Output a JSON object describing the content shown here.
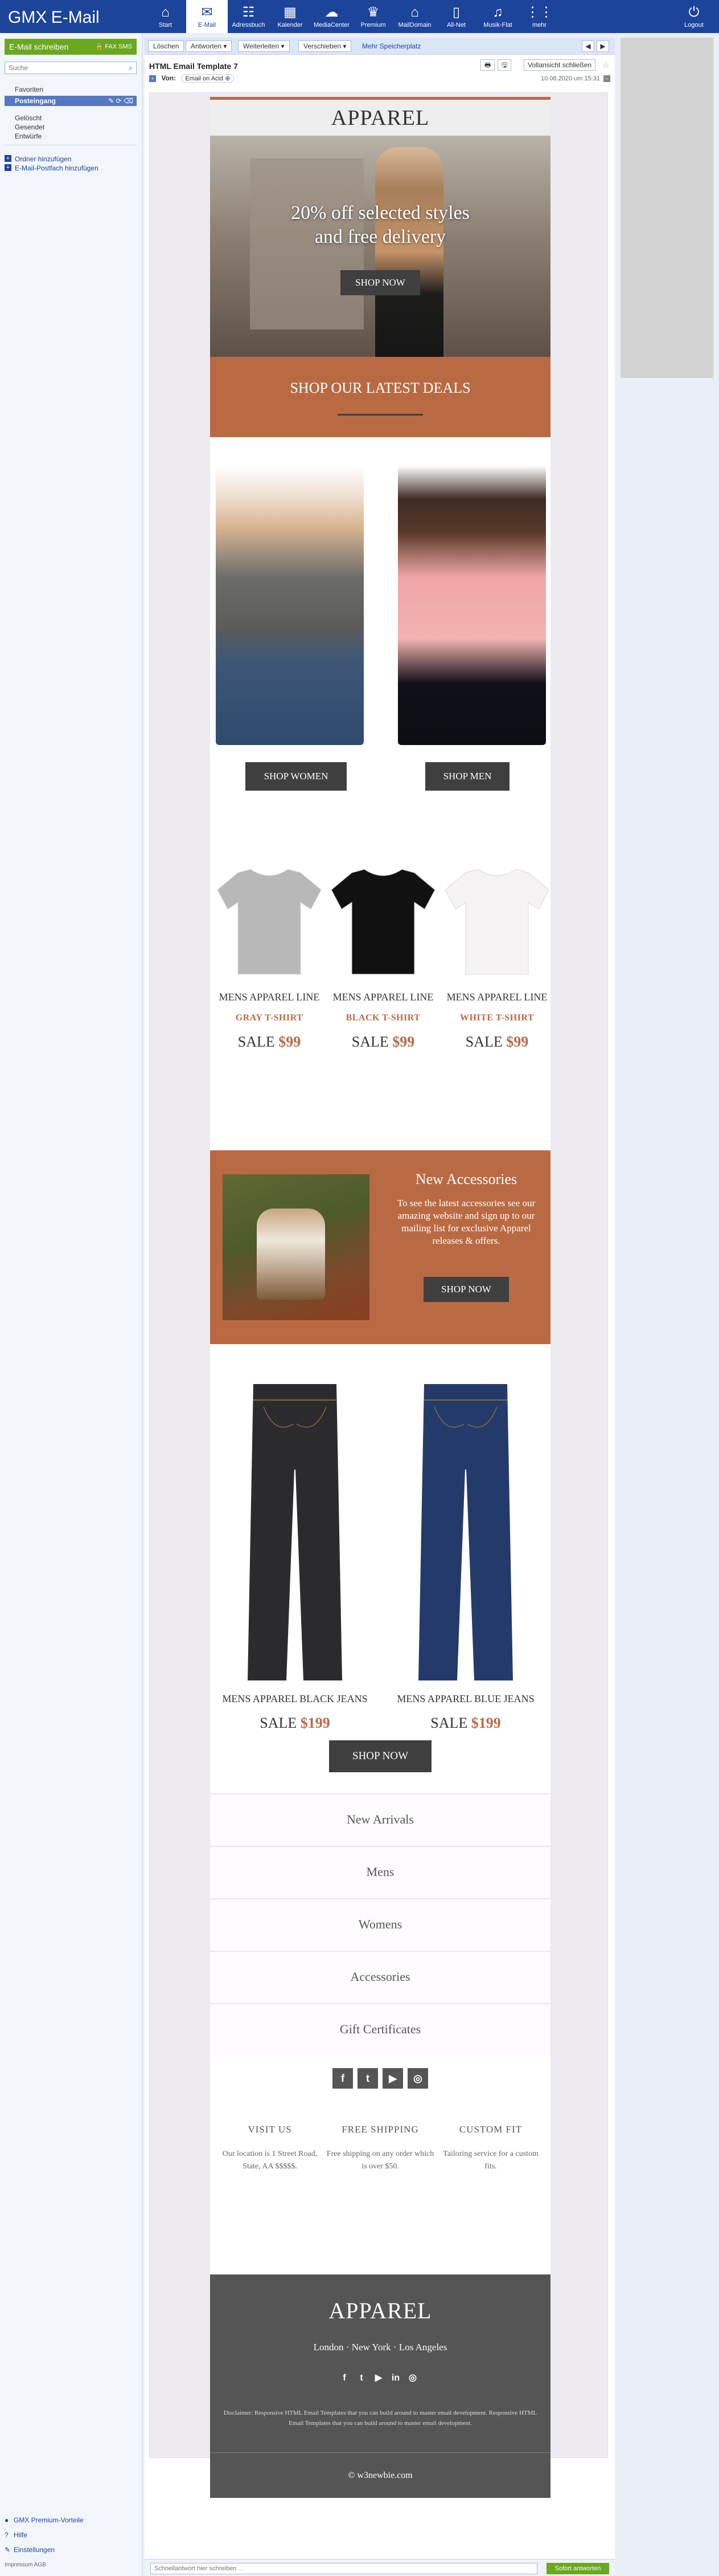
{
  "app": {
    "logo_main": "GMX",
    "logo_sub": "E-Mail",
    "nav": [
      {
        "label": "Start",
        "icon": "home-icon",
        "glyph": "⌂"
      },
      {
        "label": "E-Mail",
        "icon": "mail-icon",
        "glyph": "✉"
      },
      {
        "label": "Adressbuch",
        "icon": "addressbook-icon",
        "glyph": "☷"
      },
      {
        "label": "Kalender",
        "icon": "calendar-icon",
        "glyph": "▦"
      },
      {
        "label": "MediaCenter",
        "icon": "cloud-icon",
        "glyph": "☁"
      },
      {
        "label": "Premium",
        "icon": "crown-icon",
        "glyph": "♛"
      },
      {
        "label": "MailDomain",
        "icon": "house-icon",
        "glyph": "⌂"
      },
      {
        "label": "All-Net",
        "icon": "phone-icon",
        "glyph": "▯"
      },
      {
        "label": "Musik-Flat",
        "icon": "music-icon",
        "glyph": "♫"
      },
      {
        "label": "mehr",
        "icon": "grid-icon",
        "glyph": "⋮⋮"
      }
    ],
    "logout_label": "Logout"
  },
  "sidebar": {
    "compose_label": "E-Mail schreiben",
    "compose_extra": "🔒 FAX  SMS",
    "search_placeholder": "Suche",
    "favorites": "Favoriten",
    "inbox": "Posteingang",
    "inbox_tools": "✎ ⟳ ⌫",
    "folders": [
      "Gelöscht",
      "Gesendet",
      "Entwürfe"
    ],
    "add_folder": "Ordner hinzufügen",
    "add_mailbox": "E-Mail-Postfach hinzufügen",
    "bottom": [
      "GMX Premium-Vorteile",
      "Hilfe",
      "Einstellungen"
    ],
    "legal": "Impressum   AGB"
  },
  "toolbar": {
    "delete": "Löschen",
    "reply": "Antworten",
    "forward": "Weiterleiten",
    "move": "Verschieben",
    "more_storage": "Mehr Speicherplatz",
    "prev": "◀",
    "next": "▶"
  },
  "mail": {
    "subject": "HTML Email Template 7",
    "from_label": "Von:",
    "from_value": "Email on Acid",
    "date": "10.08.2020 um 15:31",
    "print_icon": "🖶",
    "save_icon": "🖫",
    "fullview": "Vollansicht schließen"
  },
  "email": {
    "brand": "APPAREL",
    "hero_line1": "20% off selected styles",
    "hero_line2": "and free delivery",
    "shop_now": "SHOP NOW",
    "deals_title": "SHOP OUR LATEST DEALS",
    "shop_women": "SHOP WOMEN",
    "shop_men": "SHOP MEN",
    "shirts": [
      {
        "line": "MENS APPAREL LINE",
        "name": "GRAY T-SHIRT",
        "sale": "SALE",
        "price": "$99",
        "color": "#b8b8b8"
      },
      {
        "line": "MENS APPAREL LINE",
        "name": "BLACK T-SHIRT",
        "sale": "SALE",
        "price": "$99",
        "color": "#111111"
      },
      {
        "line": "MENS APPAREL LINE",
        "name": "WHITE T-SHIRT",
        "sale": "SALE",
        "price": "$99",
        "color": "#f6f3f4"
      }
    ],
    "accessories_title": "New Accessories",
    "accessories_text": "To see the latest accessories see our amazing website and sign up to our mailing list for exclusive Apparel releases & offers.",
    "jeans": [
      {
        "name": "MENS APPAREL BLACK JEANS",
        "sale": "SALE",
        "price": "$199",
        "color": "#2b2b2e"
      },
      {
        "name": "MENS APPAREL BLUE JEANS",
        "sale": "SALE",
        "price": "$199",
        "color": "#233a6a"
      }
    ],
    "menu": [
      "New Arrivals",
      "Mens",
      "Womens",
      "Accessories",
      "Gift Certificates"
    ],
    "social": [
      "f",
      "t",
      "▶",
      "◎"
    ],
    "info": [
      {
        "title": "VISIT US",
        "text": "Our location is 1 Street Road, State, AA $$$$$."
      },
      {
        "title": "FREE SHIPPING",
        "text": "Free shipping on any order which is over $50."
      },
      {
        "title": "CUSTOM FIT",
        "text": "Tailoring service for a custom fits."
      }
    ],
    "footer_brand": "APPAREL",
    "footer_cities": "London · New York · Los Angeles",
    "footer_social": [
      "f",
      "t",
      "▶",
      "in",
      "◎"
    ],
    "disclaimer": "Disclaimer: Responsive HTML Email Templates that you can build around to master email development. Responsive HTML Email Templates that you can build around to master email development.",
    "copyright": "© w3newbie.com"
  },
  "reply": {
    "placeholder": "Schnellantwort hier schreiben ...",
    "button": "Sofort antworten"
  }
}
